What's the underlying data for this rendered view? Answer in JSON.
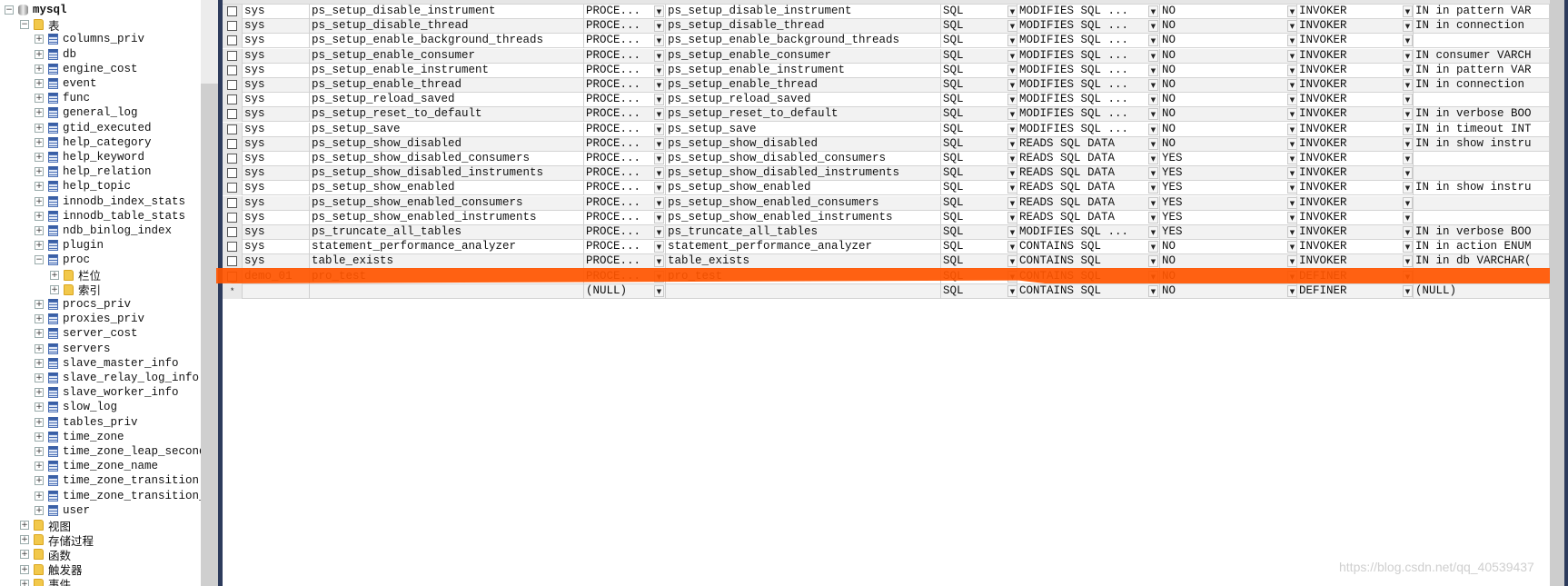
{
  "tree": {
    "root": "mysql",
    "tables_folder": "表",
    "tables": [
      "columns_priv",
      "db",
      "engine_cost",
      "event",
      "func",
      "general_log",
      "gtid_executed",
      "help_category",
      "help_keyword",
      "help_relation",
      "help_topic",
      "innodb_index_stats",
      "innodb_table_stats",
      "ndb_binlog_index",
      "plugin",
      "proc"
    ],
    "proc_children": [
      "栏位",
      "索引"
    ],
    "tables_after": [
      "procs_priv",
      "proxies_priv",
      "server_cost",
      "servers",
      "slave_master_info",
      "slave_relay_log_info",
      "slave_worker_info",
      "slow_log",
      "tables_priv",
      "time_zone",
      "time_zone_leap_second",
      "time_zone_name",
      "time_zone_transition",
      "time_zone_transition_",
      "user"
    ],
    "folders": [
      "视图",
      "存储过程",
      "函数",
      "触发器",
      "事件"
    ]
  },
  "grid": {
    "rows": [
      [
        "sys",
        "ps_setup_disable_instrument",
        "PROCE...",
        "ps_setup_disable_instrument",
        "SQL",
        "MODIFIES SQL ...",
        "NO",
        "INVOKER",
        "IN in pattern VAR"
      ],
      [
        "sys",
        "ps_setup_disable_thread",
        "PROCE...",
        "ps_setup_disable_thread",
        "SQL",
        "MODIFIES SQL ...",
        "NO",
        "INVOKER",
        "IN in connection"
      ],
      [
        "sys",
        "ps_setup_enable_background_threads",
        "PROCE...",
        "ps_setup_enable_background_threads",
        "SQL",
        "MODIFIES SQL ...",
        "NO",
        "INVOKER",
        ""
      ],
      [
        "sys",
        "ps_setup_enable_consumer",
        "PROCE...",
        "ps_setup_enable_consumer",
        "SQL",
        "MODIFIES SQL ...",
        "NO",
        "INVOKER",
        "IN consumer VARCH"
      ],
      [
        "sys",
        "ps_setup_enable_instrument",
        "PROCE...",
        "ps_setup_enable_instrument",
        "SQL",
        "MODIFIES SQL ...",
        "NO",
        "INVOKER",
        "IN in pattern VAR"
      ],
      [
        "sys",
        "ps_setup_enable_thread",
        "PROCE...",
        "ps_setup_enable_thread",
        "SQL",
        "MODIFIES SQL ...",
        "NO",
        "INVOKER",
        "IN in connection"
      ],
      [
        "sys",
        "ps_setup_reload_saved",
        "PROCE...",
        "ps_setup_reload_saved",
        "SQL",
        "MODIFIES SQL ...",
        "NO",
        "INVOKER",
        ""
      ],
      [
        "sys",
        "ps_setup_reset_to_default",
        "PROCE...",
        "ps_setup_reset_to_default",
        "SQL",
        "MODIFIES SQL ...",
        "NO",
        "INVOKER",
        "IN in verbose BOO"
      ],
      [
        "sys",
        "ps_setup_save",
        "PROCE...",
        "ps_setup_save",
        "SQL",
        "MODIFIES SQL ...",
        "NO",
        "INVOKER",
        "IN in timeout INT"
      ],
      [
        "sys",
        "ps_setup_show_disabled",
        "PROCE...",
        "ps_setup_show_disabled",
        "SQL",
        "READS SQL DATA",
        "NO",
        "INVOKER",
        "IN in show instru"
      ],
      [
        "sys",
        "ps_setup_show_disabled_consumers",
        "PROCE...",
        "ps_setup_show_disabled_consumers",
        "SQL",
        "READS SQL DATA",
        "YES",
        "INVOKER",
        ""
      ],
      [
        "sys",
        "ps_setup_show_disabled_instruments",
        "PROCE...",
        "ps_setup_show_disabled_instruments",
        "SQL",
        "READS SQL DATA",
        "YES",
        "INVOKER",
        ""
      ],
      [
        "sys",
        "ps_setup_show_enabled",
        "PROCE...",
        "ps_setup_show_enabled",
        "SQL",
        "READS SQL DATA",
        "YES",
        "INVOKER",
        "IN in show instru"
      ],
      [
        "sys",
        "ps_setup_show_enabled_consumers",
        "PROCE...",
        "ps_setup_show_enabled_consumers",
        "SQL",
        "READS SQL DATA",
        "YES",
        "INVOKER",
        ""
      ],
      [
        "sys",
        "ps_setup_show_enabled_instruments",
        "PROCE...",
        "ps_setup_show_enabled_instruments",
        "SQL",
        "READS SQL DATA",
        "YES",
        "INVOKER",
        ""
      ],
      [
        "sys",
        "ps_truncate_all_tables",
        "PROCE...",
        "ps_truncate_all_tables",
        "SQL",
        "MODIFIES SQL ...",
        "YES",
        "INVOKER",
        "IN in verbose BOO"
      ],
      [
        "sys",
        "statement_performance_analyzer",
        "PROCE...",
        "statement_performance_analyzer",
        "SQL",
        "CONTAINS SQL",
        "NO",
        "INVOKER",
        "IN in action ENUM"
      ],
      [
        "sys",
        "table_exists",
        "PROCE...",
        "table_exists",
        "SQL",
        "CONTAINS SQL",
        "NO",
        "INVOKER",
        "IN in db VARCHAR("
      ],
      [
        "demo_01",
        "pro_test",
        "PROCE...",
        "pro_test",
        "SQL",
        "CONTAINS SQL",
        "NO",
        "DEFINER",
        ""
      ]
    ],
    "new_row": {
      "marker": "*",
      "type": "(NULL)",
      "language": "SQL",
      "access": "CONTAINS SQL",
      "deterministic": "NO",
      "security": "DEFINER",
      "params": "(NULL)"
    },
    "highlight_color": "#ff5500"
  },
  "watermark": "https://blog.csdn.net/qq_40539437"
}
